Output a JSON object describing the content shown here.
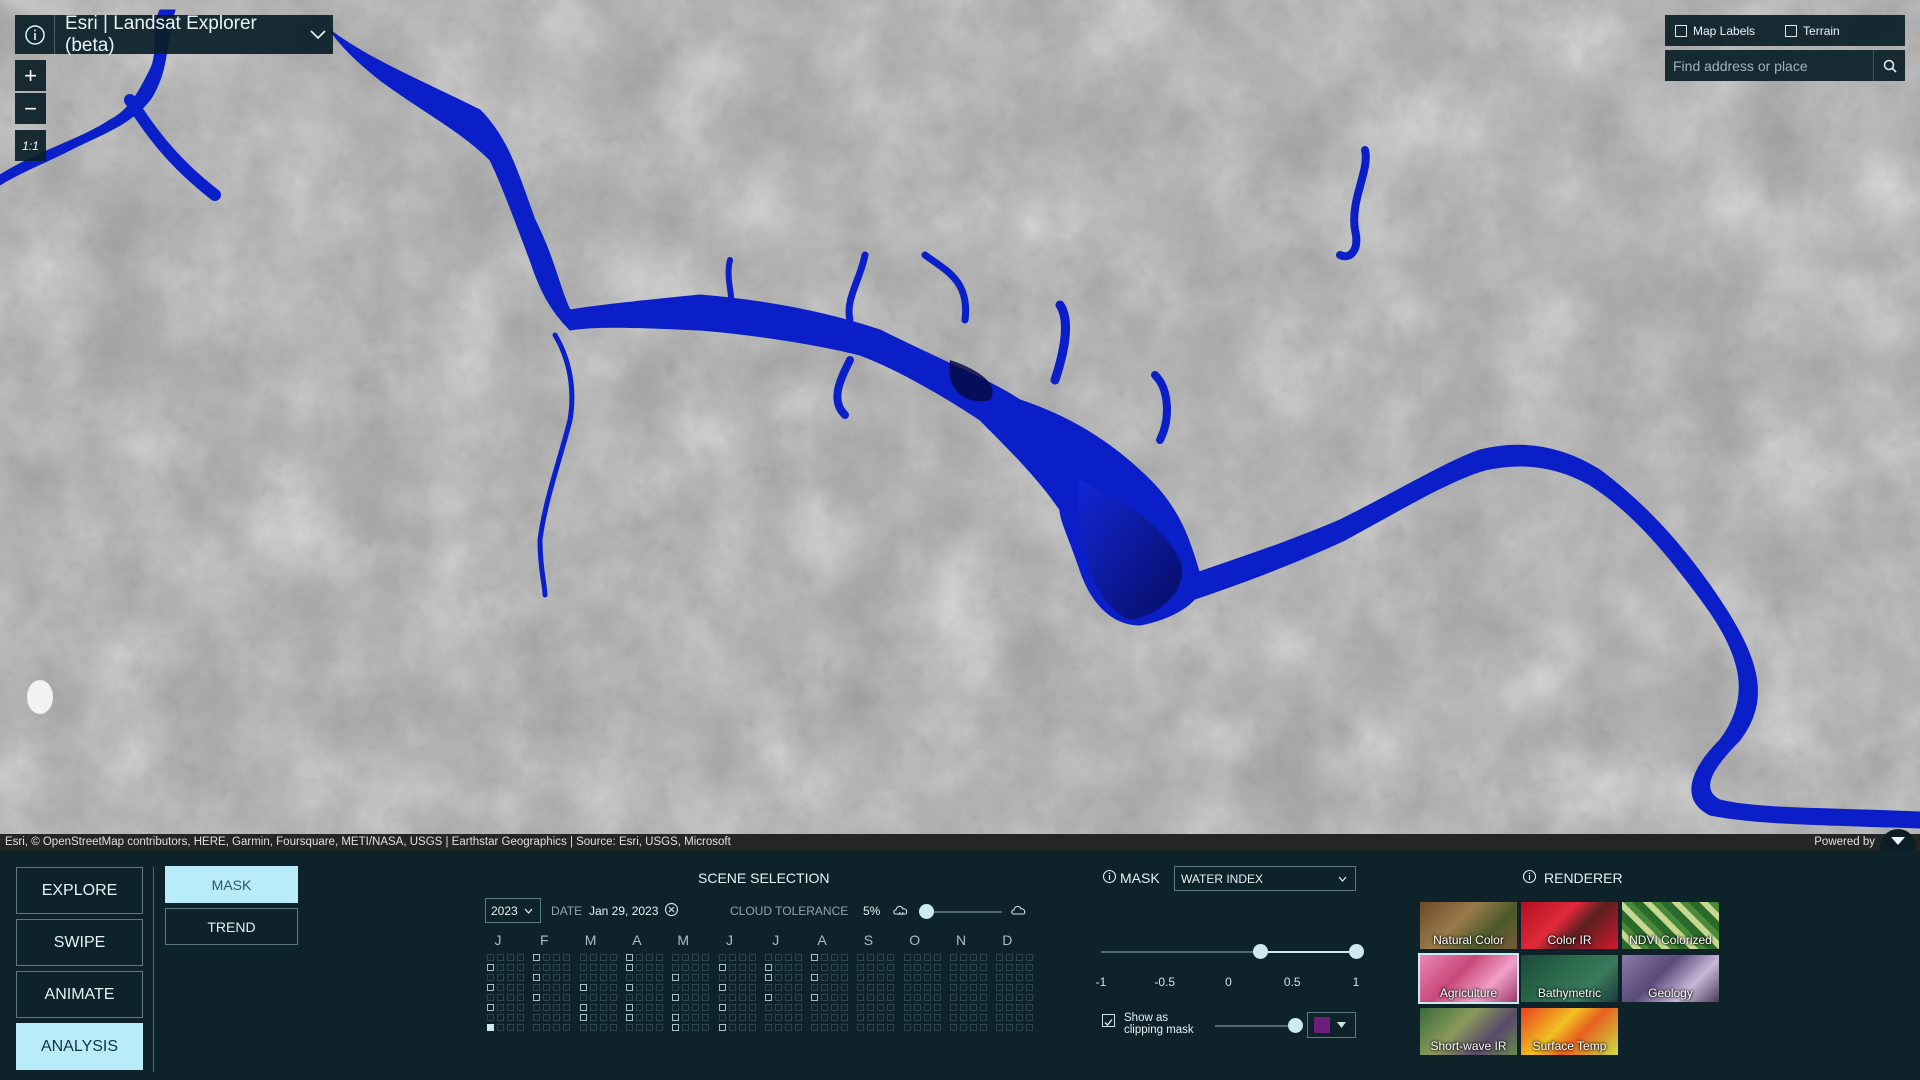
{
  "app": {
    "title": "Esri | Landsat Explorer (beta)"
  },
  "map": {
    "zoom_in": "+",
    "zoom_out": "−",
    "scale_label": "1:1",
    "toggles": [
      {
        "label": "Map Labels",
        "checked": false
      },
      {
        "label": "Terrain",
        "checked": false
      }
    ],
    "search_placeholder": "Find address or place",
    "attribution": "Esri, © OpenStreetMap contributors, HERE, Garmin, Foursquare, METI/NASA, USGS | Earthstar Geographics | Source: Esri, USGS, Microsoft",
    "powered_by": "Powered by"
  },
  "modes": [
    {
      "label": "EXPLORE",
      "active": false
    },
    {
      "label": "SWIPE",
      "active": false
    },
    {
      "label": "ANIMATE",
      "active": false
    },
    {
      "label": "ANALYSIS",
      "active": true
    }
  ],
  "analysis_tools": [
    {
      "label": "MASK",
      "active": true
    },
    {
      "label": "TREND",
      "active": false
    }
  ],
  "scene_selection": {
    "title": "SCENE SELECTION",
    "year": "2023",
    "date_label": "DATE",
    "date_value": "Jan 29, 2023",
    "cloud_label": "CLOUD TOLERANCE",
    "cloud_value": "5%",
    "cloud_fraction": 0.05,
    "months": [
      "J",
      "F",
      "M",
      "A",
      "M",
      "J",
      "J",
      "A",
      "S",
      "O",
      "N",
      "D"
    ]
  },
  "mask": {
    "title": "MASK",
    "index_selected": "WATER INDEX",
    "range_low": 0.25,
    "range_high": 1,
    "ticks": [
      "-1",
      "-0.5",
      "0",
      "0.5",
      "1"
    ],
    "clip_label": "Show as clipping mask",
    "clip_checked": true,
    "opacity": 1,
    "mask_color": "#6b1f7a"
  },
  "renderer": {
    "title": "RENDERER",
    "tiles": [
      {
        "label": "Natural Color",
        "active": false
      },
      {
        "label": "Color IR",
        "active": false
      },
      {
        "label": "NDVI Colorized",
        "active": false
      },
      {
        "label": "Agriculture",
        "active": true
      },
      {
        "label": "Bathymetric",
        "active": false
      },
      {
        "label": "Geology",
        "active": false
      },
      {
        "label": "Short-wave IR",
        "active": false
      },
      {
        "label": "Surface Temp",
        "active": false
      }
    ]
  },
  "colors": {
    "panel_bg": "#0d2229",
    "accent": "#b8ecf8",
    "water_mask": "#0a1fc8"
  }
}
